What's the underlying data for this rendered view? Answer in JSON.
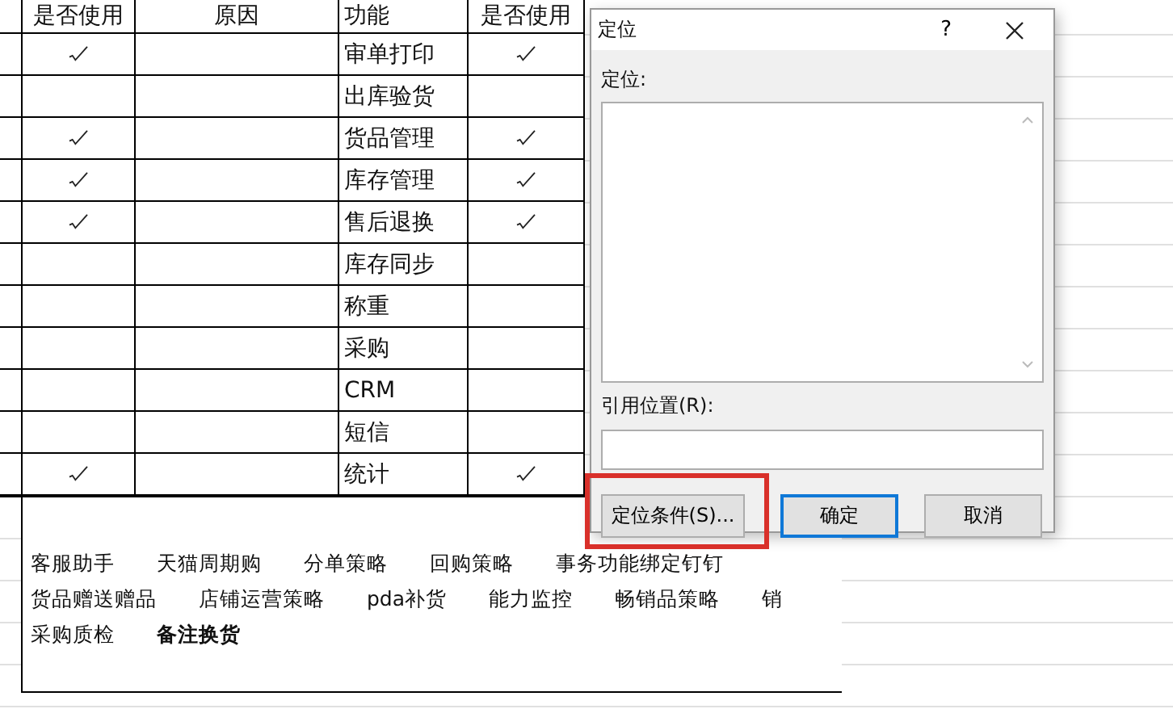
{
  "table": {
    "columns": [
      "是否使用",
      "原因",
      "功能",
      "是否使用"
    ],
    "rows": [
      {
        "function": "审单打印",
        "used_left": true,
        "used_right": true
      },
      {
        "function": "出库验货",
        "used_left": false,
        "used_right": false
      },
      {
        "function": "货品管理",
        "used_left": true,
        "used_right": true
      },
      {
        "function": "库存管理",
        "used_left": true,
        "used_right": true
      },
      {
        "function": "售后退换",
        "used_left": true,
        "used_right": true
      },
      {
        "function": "库存同步",
        "used_left": false,
        "used_right": false
      },
      {
        "function": "称重",
        "used_left": false,
        "used_right": false
      },
      {
        "function": "采购",
        "used_left": false,
        "used_right": false
      },
      {
        "function": "CRM",
        "used_left": false,
        "used_right": false
      },
      {
        "function": "短信",
        "used_left": false,
        "used_right": false
      },
      {
        "function": "统计",
        "used_left": true,
        "used_right": true
      }
    ]
  },
  "notes": [
    [
      {
        "text": "客服助手",
        "bold": false
      },
      {
        "text": "天猫周期购",
        "bold": false
      },
      {
        "text": "分单策略",
        "bold": false
      },
      {
        "text": "回购策略",
        "bold": false
      },
      {
        "text": "事务功能绑定钉钉",
        "bold": false
      }
    ],
    [
      {
        "text": "货品赠送赠品",
        "bold": false
      },
      {
        "text": "店铺运营策略",
        "bold": false
      },
      {
        "text": "pda补货",
        "bold": false
      },
      {
        "text": "能力监控",
        "bold": false
      },
      {
        "text": "畅销品策略",
        "bold": false
      },
      {
        "text": "销",
        "bold": false
      }
    ],
    [
      {
        "text": "采购质检",
        "bold": false
      },
      {
        "text": "备注换货",
        "bold": true
      }
    ]
  ],
  "dialog": {
    "title": "定位",
    "help": "?",
    "list_label": "定位:",
    "reference_label": "引用位置(R):",
    "buttons": [
      {
        "label": "定位条件(S)...",
        "default": false,
        "highlighted": true
      },
      {
        "label": "确定",
        "default": true,
        "highlighted": false
      },
      {
        "label": "取消",
        "default": false,
        "highlighted": false
      }
    ]
  }
}
